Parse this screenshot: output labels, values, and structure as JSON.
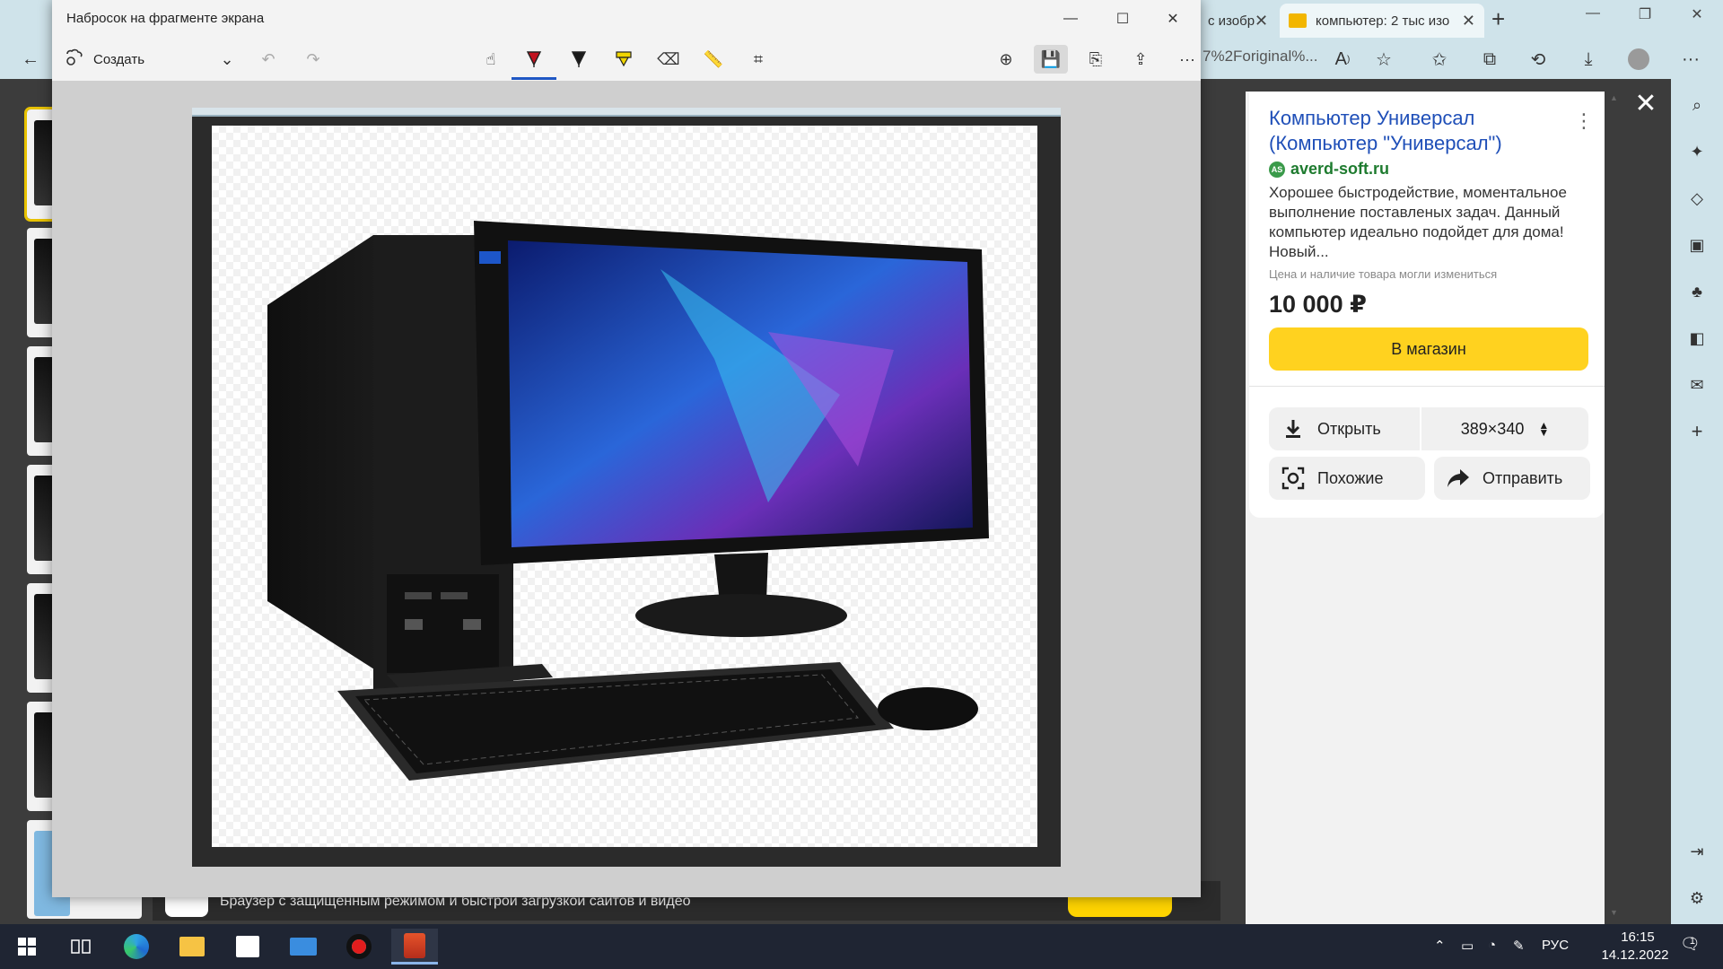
{
  "browser": {
    "tabs": [
      {
        "label": "с изобр"
      },
      {
        "label": "компьютер: 2 тыс изо"
      }
    ],
    "address_text": "7%2Foriginal%..."
  },
  "page": {
    "promo_text": "Браузер с защищённым режимом и быстрой загрузкой сайтов и видео"
  },
  "snip": {
    "title": "Набросок на фрагменте экрана",
    "create_label": "Создать"
  },
  "info_panel": {
    "title": "Компьютер Универсал (Компьютер \"Универсал\")",
    "source_badge": "AS",
    "source": "averd-soft.ru",
    "description": "Хорошее быстродействие, моментальное выполнение поставленых задач. Данный компьютер идеально подойдет для дома! Новый...",
    "note": "Цена и наличие товара могли измениться",
    "price": "10 000 ₽",
    "shop_button": "В магазин",
    "open_button": "Открыть",
    "size": "389×340",
    "similar_button": "Похожие",
    "share_button": "Отправить"
  },
  "taskbar": {
    "language": "РУС",
    "time": "16:15",
    "date": "14.12.2022",
    "notification_count": "1"
  },
  "colors": {
    "browser_chrome": "#cfe3ea",
    "accent_yellow": "#ffd21f",
    "link_blue": "#1f4fb8",
    "source_green": "#1e7b2f",
    "pen_active": "#1f57c4",
    "taskbar": "#1f2533"
  },
  "icons": {
    "snip_tools": [
      "touch-writing-icon",
      "ballpoint-pen-icon",
      "pencil-icon",
      "highlighter-icon",
      "eraser-icon",
      "ruler-icon",
      "crop-icon"
    ],
    "snip_actions": [
      "zoom-icon",
      "save-icon",
      "copy-icon",
      "share-icon",
      "more-icon"
    ]
  }
}
